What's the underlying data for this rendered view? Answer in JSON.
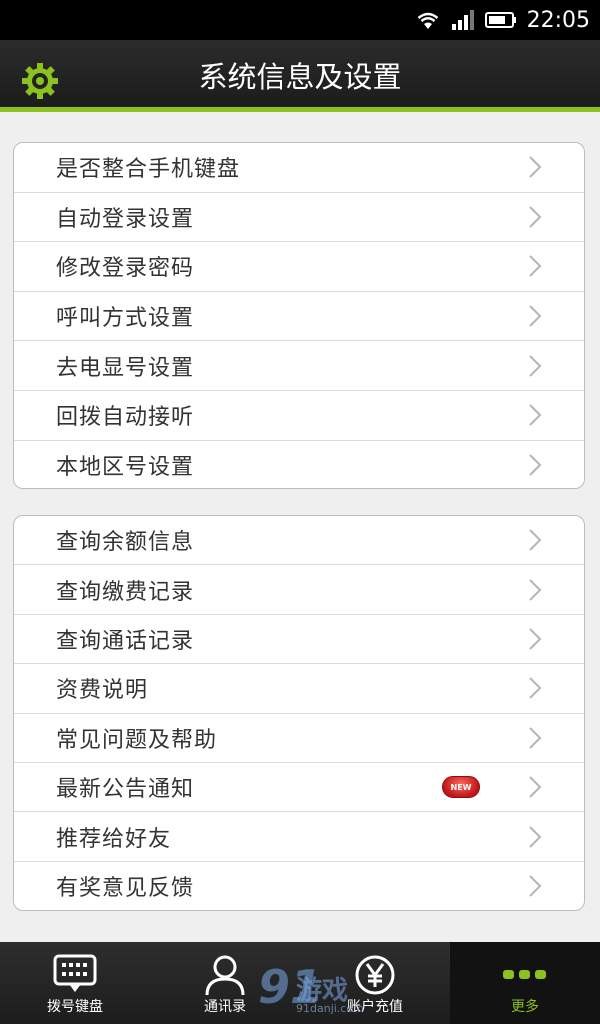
{
  "status_bar": {
    "time": "22:05"
  },
  "header": {
    "title": "系统信息及设置",
    "settings_icon": "gear-icon"
  },
  "accent_color": "#8cc21f",
  "group1": [
    "是否整合手机键盘",
    "自动登录设置",
    "修改登录密码",
    "呼叫方式设置",
    "去电显号设置",
    "回拨自动接听",
    "本地区号设置"
  ],
  "group2": [
    "查询余额信息",
    "查询缴费记录",
    "查询通话记录",
    "资费说明",
    "常见问题及帮助",
    "最新公告通知",
    "推荐给好友",
    "有奖意见反馈"
  ],
  "new_badge": "NEW",
  "bottom_nav": [
    {
      "label": "拨号键盘",
      "icon": "dialpad-icon"
    },
    {
      "label": "通讯录",
      "icon": "contacts-icon"
    },
    {
      "label": "账户充值",
      "icon": "yen-icon"
    },
    {
      "label": "更多",
      "icon": "more-icon",
      "active": true
    }
  ],
  "watermark": {
    "number": "91",
    "text": "游戏",
    "url": "91danji.com"
  }
}
